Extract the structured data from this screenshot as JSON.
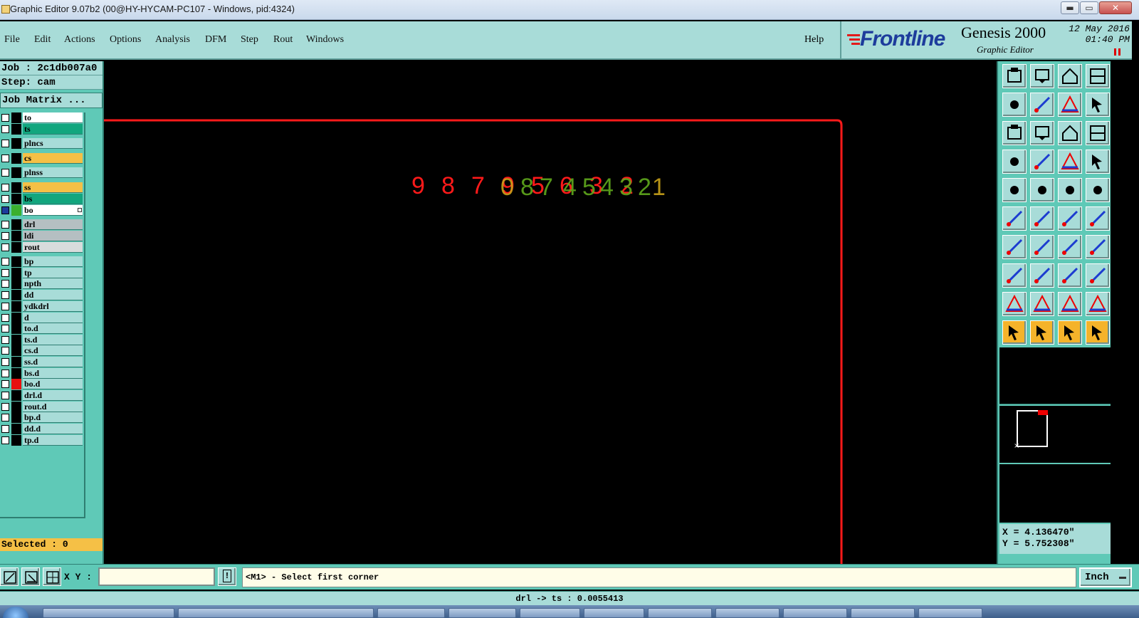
{
  "window": {
    "title": "Graphic Editor 9.07b2 (00@HY-HYCAM-PC107 - Windows, pid:4324)",
    "controls": {
      "minimize": "▬",
      "maximize": "▭",
      "close": "✕"
    }
  },
  "menubar": {
    "items": [
      "File",
      "Edit",
      "Actions",
      "Options",
      "Analysis",
      "DFM",
      "Step",
      "Rout",
      "Windows"
    ],
    "help": "Help"
  },
  "brand": {
    "logo": "Frontline",
    "product": "Genesis 2000",
    "subtitle": "Graphic Editor",
    "date": "12 May 2016",
    "time": "01:40 PM"
  },
  "job": {
    "job_line": "Job : 2c1db007a0",
    "step_line": "Step: cam",
    "matrix_button": "Job Matrix ..."
  },
  "layers": [
    {
      "name": "to",
      "bg": "#ffffff",
      "swatch": "#000000"
    },
    {
      "name": "ts",
      "bg": "#12a67e",
      "swatch": "#000000"
    },
    {
      "name": "plncs",
      "bg": "#a8dcd8",
      "swatch": "#000000"
    },
    {
      "name": "cs",
      "bg": "#f5c046",
      "swatch": "#000000"
    },
    {
      "name": "plnss",
      "bg": "#a8dcd8",
      "swatch": "#000000"
    },
    {
      "name": "ss",
      "bg": "#f5c046",
      "swatch": "#000000"
    },
    {
      "name": "bs",
      "bg": "#12a67e",
      "swatch": "#000000"
    },
    {
      "name": "bo",
      "bg": "#ffffff",
      "swatch": "#3bb02f",
      "active": true
    },
    {
      "name": "drl",
      "bg": "#b5bfc2",
      "swatch": "#000000"
    },
    {
      "name": "ldi",
      "bg": "#b5bfc2",
      "swatch": "#000000"
    },
    {
      "name": "rout",
      "bg": "#d8dcdc",
      "swatch": "#000000"
    },
    {
      "name": "bp",
      "bg": "#a8dcd8",
      "swatch": "#000000"
    },
    {
      "name": "tp",
      "bg": "#a8dcd8",
      "swatch": "#000000"
    },
    {
      "name": "npth",
      "bg": "#a8dcd8",
      "swatch": "#000000"
    },
    {
      "name": "dd",
      "bg": "#a8dcd8",
      "swatch": "#000000"
    },
    {
      "name": "ydkdrl",
      "bg": "#a8dcd8",
      "swatch": "#000000"
    },
    {
      "name": "d",
      "bg": "#a8dcd8",
      "swatch": "#000000"
    },
    {
      "name": "to.d",
      "bg": "#a8dcd8",
      "swatch": "#000000"
    },
    {
      "name": "ts.d",
      "bg": "#a8dcd8",
      "swatch": "#000000"
    },
    {
      "name": "cs.d",
      "bg": "#a8dcd8",
      "swatch": "#000000"
    },
    {
      "name": "ss.d",
      "bg": "#a8dcd8",
      "swatch": "#000000"
    },
    {
      "name": "bs.d",
      "bg": "#a8dcd8",
      "swatch": "#000000"
    },
    {
      "name": "bo.d",
      "bg": "#a8dcd8",
      "swatch": "#e81010"
    },
    {
      "name": "drl.d",
      "bg": "#a8dcd8",
      "swatch": "#000000"
    },
    {
      "name": "rout.d",
      "bg": "#a8dcd8",
      "swatch": "#000000"
    },
    {
      "name": "bp.d",
      "bg": "#a8dcd8",
      "swatch": "#000000"
    },
    {
      "name": "dd.d",
      "bg": "#a8dcd8",
      "swatch": "#000000"
    },
    {
      "name": "tp.d",
      "bg": "#a8dcd8",
      "swatch": "#000000"
    }
  ],
  "selected": "Selected : 0",
  "canvas": {
    "red_digits": [
      "9",
      "8",
      "7",
      "9",
      "5",
      "6",
      "3",
      "2"
    ],
    "green_digits": [
      "0",
      "8",
      "7",
      "4",
      "5",
      "4",
      "3",
      "2",
      "1"
    ]
  },
  "toolbar": {
    "icons": [
      "layer-up-icon",
      "layer-down-icon",
      "home-icon",
      "window-icon",
      "pan-left-icon",
      "pan-right-icon",
      "zoom-home-icon",
      "redraw-icon",
      "fit-window-icon",
      "zoom-out-icon",
      "one-to-one-icon",
      "help-query-icon",
      "settings-icon",
      "grid-icon",
      "snap-icon",
      "snap-red-icon",
      "camera-icon",
      "erase-icon",
      "measure-ruler-icon",
      "pad-icon",
      "netlist-icon",
      "cross-icon",
      "line-node-icon",
      "line-node-red-icon",
      "draw-line-icon",
      "draw-arc-icon",
      "arc-icon",
      "line-break-icon",
      "feature-node-icon",
      "feature-minus-icon",
      "feature-box-icon",
      "feature-group-icon",
      "triangle-1-icon",
      "triangle-2-icon",
      "triangle-3-icon",
      "triangle-4-icon",
      "select-icon",
      "select-2-icon",
      "select-3-icon",
      "select-4-icon"
    ],
    "overview_marker": "×"
  },
  "coords": {
    "x": "X = 4.136470\"",
    "y": "Y = 5.752308\""
  },
  "input": {
    "xy_label": "X Y :",
    "xy_value": "",
    "exclaim": "!",
    "prompt": "<M1> - Select first corner",
    "units": "Inch"
  },
  "status": {
    "text": "drl -> ts : 0.0055413"
  },
  "colors": {
    "panel": "#5fc9b7",
    "light": "#a8dcd8",
    "outline_red": "#ff1a1a",
    "text_red": "#ff1a1a",
    "text_green": "#5fa81c"
  }
}
